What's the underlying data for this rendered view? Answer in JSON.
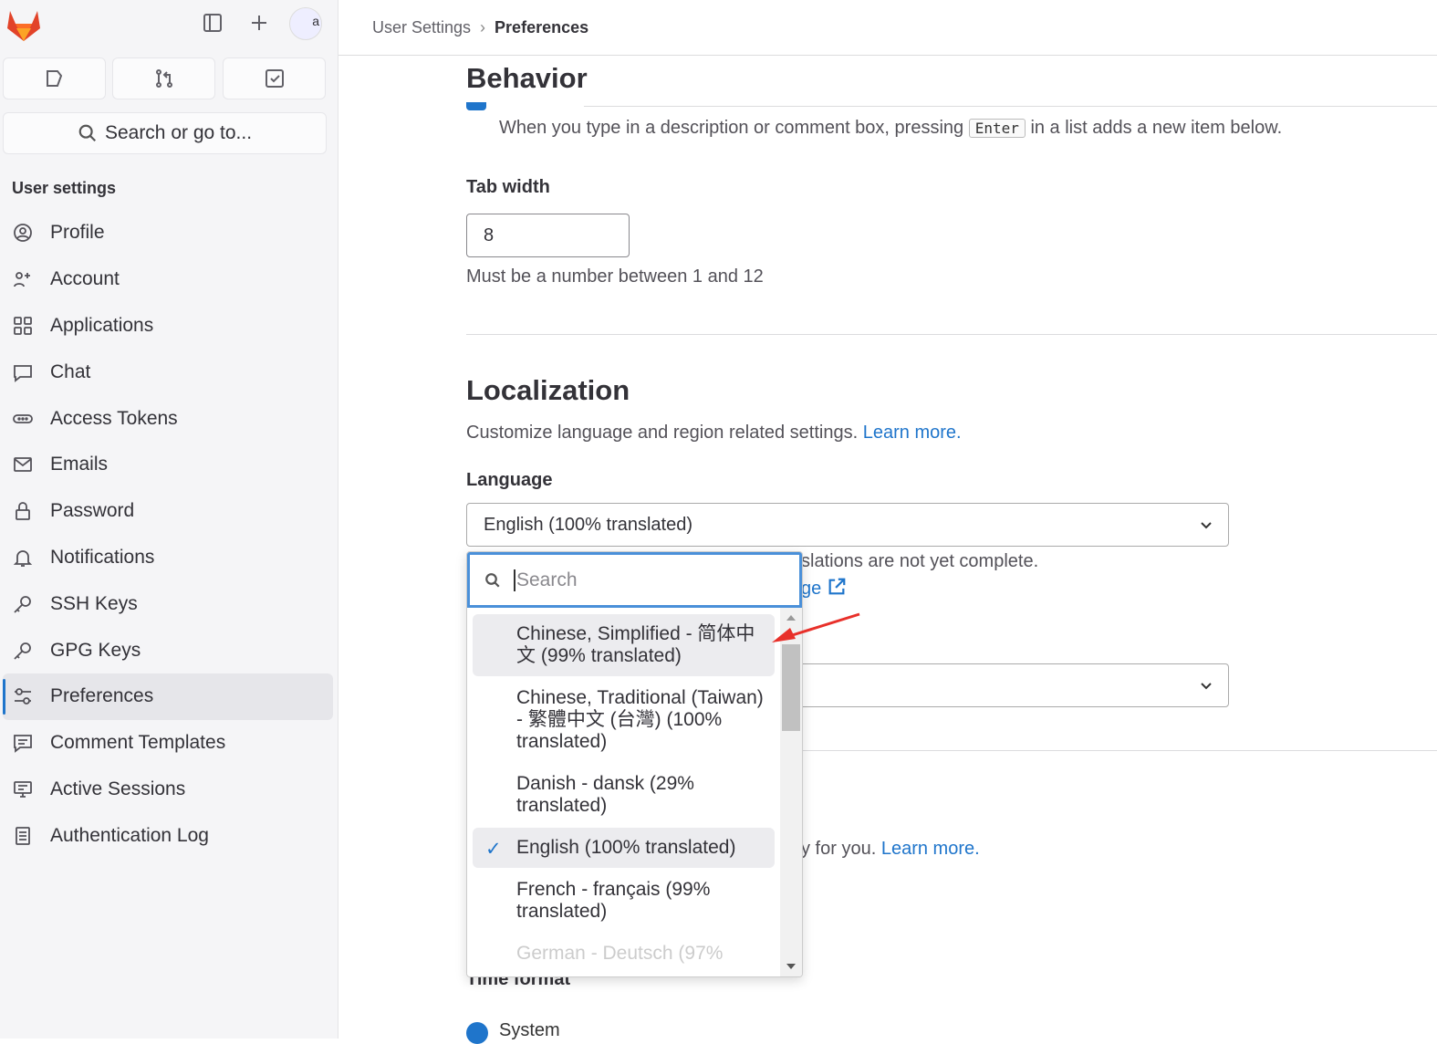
{
  "sidebar": {
    "section_title": "User settings",
    "search_label": "Search or go to...",
    "avatar_alt": "a",
    "items": [
      {
        "label": "Profile",
        "icon": "profile-icon"
      },
      {
        "label": "Account",
        "icon": "account-icon"
      },
      {
        "label": "Applications",
        "icon": "applications-icon"
      },
      {
        "label": "Chat",
        "icon": "chat-icon"
      },
      {
        "label": "Access Tokens",
        "icon": "token-icon"
      },
      {
        "label": "Emails",
        "icon": "mail-icon"
      },
      {
        "label": "Password",
        "icon": "lock-icon"
      },
      {
        "label": "Notifications",
        "icon": "bell-icon"
      },
      {
        "label": "SSH Keys",
        "icon": "key-icon"
      },
      {
        "label": "GPG Keys",
        "icon": "key-icon"
      },
      {
        "label": "Preferences",
        "icon": "preferences-icon",
        "active": true
      },
      {
        "label": "Comment Templates",
        "icon": "comment-icon"
      },
      {
        "label": "Active Sessions",
        "icon": "monitor-icon"
      },
      {
        "label": "Authentication Log",
        "icon": "log-icon"
      }
    ]
  },
  "breadcrumb": {
    "parent": "User Settings",
    "current": "Preferences"
  },
  "behavior": {
    "title": "Behavior",
    "help_before": "When you type in a description or comment box, pressing",
    "key": "Enter",
    "help_after": "in a list adds a new item below."
  },
  "tab_width": {
    "label": "Tab width",
    "value": "8",
    "help": "Must be a number between 1 and 12"
  },
  "localization": {
    "title": "Localization",
    "description": "Customize language and region related settings.",
    "learn_more": "Learn more.",
    "language_label": "Language",
    "language_value": "English (100% translated)",
    "partial_help": "slations are not yet complete.",
    "partial_link": "ge",
    "partial_text2": "y for you.",
    "learn_more2": "Learn more.",
    "time_format_label": "Time format",
    "time_format_option": "System"
  },
  "dropdown": {
    "search_placeholder": "Search",
    "options": [
      {
        "label": "Chinese, Simplified - 简体中文 (99% translated)",
        "highlighted": true
      },
      {
        "label": "Chinese, Traditional (Taiwan) - 繁體中文 (台灣) (100% translated)"
      },
      {
        "label": "Danish - dansk (29% translated)"
      },
      {
        "label": "English (100% translated)",
        "selected": true
      },
      {
        "label": "French - français (99% translated)"
      },
      {
        "label": "German - Deutsch (97%"
      }
    ]
  },
  "colors": {
    "accent": "#1f75cb",
    "annotation_arrow": "#e8302a"
  }
}
